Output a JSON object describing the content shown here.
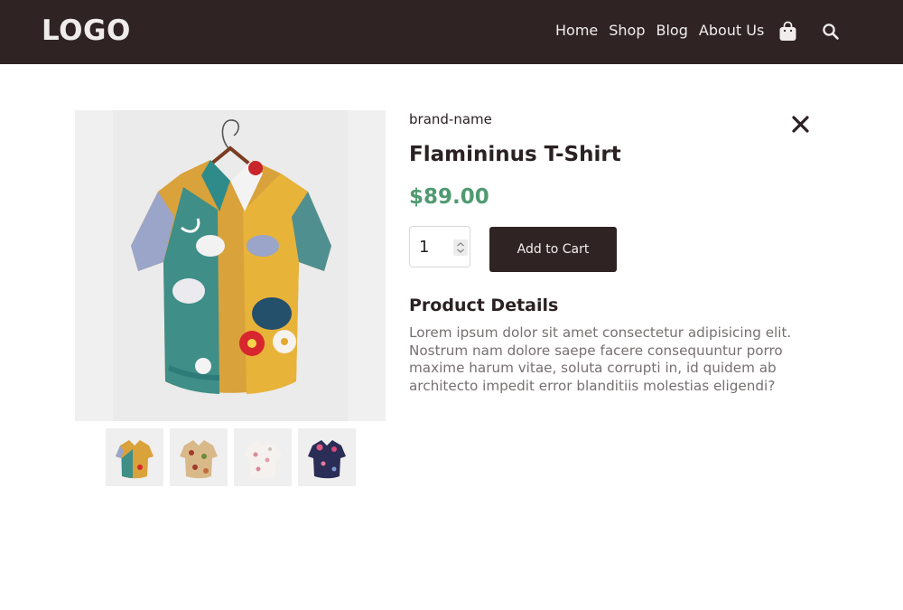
{
  "header": {
    "logo": "LOGO",
    "nav": [
      "Home",
      "Shop",
      "Blog",
      "About Us"
    ],
    "icons": [
      "shopping-bag-icon",
      "search-icon"
    ]
  },
  "product": {
    "brand": "brand-name",
    "title": "Flamininus T-Shirt",
    "price": "$89.00",
    "quantity": "1",
    "add_to_cart_label": "Add to Cart",
    "details_title": "Product Details",
    "details_text": "Lorem ipsum dolor sit amet consectetur adipisicing elit. Nostrum nam dolore saepe facere consequuntur porro maxime harum vitae, soluta corrupti in, id quidem ab architecto impedit error blanditiis molestias eligendi?"
  },
  "colors": {
    "header_bg": "#2f2323",
    "price": "#4f9a71",
    "button_bg": "#2f2323",
    "text_muted": "#777070"
  }
}
